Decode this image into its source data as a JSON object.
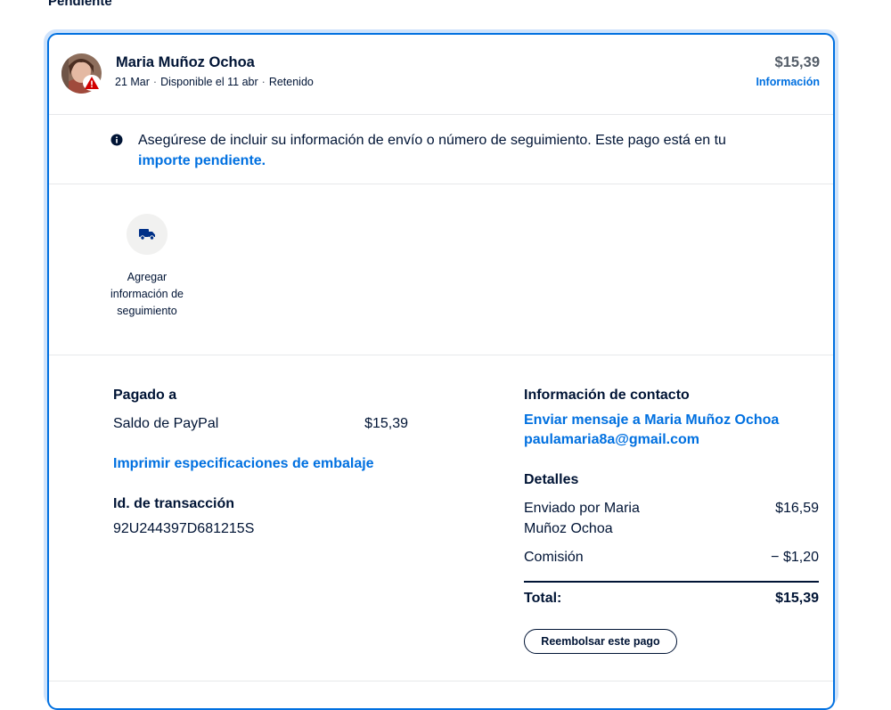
{
  "section": {
    "title": "Pendiente"
  },
  "header": {
    "name": "Maria Muñoz Ochoa",
    "date": "21 Mar",
    "available": "Disponible el 11 abr",
    "status": "Retenido",
    "amount": "$15,39",
    "info_link": "Información"
  },
  "notice": {
    "text": "Asegúrese de incluir su información de envío o número de seguimiento. Este pago está en tu",
    "link": "importe pendiente."
  },
  "tracking": {
    "label": "Agregar información de seguimiento",
    "icon": "truck-icon"
  },
  "paid_to": {
    "heading": "Pagado a",
    "source": "Saldo de PayPal",
    "amount": "$15,39",
    "print_link": "Imprimir especificaciones de embalaje"
  },
  "transaction": {
    "heading": "Id. de transacción",
    "id": "92U244397D681215S"
  },
  "contact": {
    "heading": "Información de contacto",
    "message_link": "Enviar mensaje a Maria Muñoz Ochoa",
    "email": "paulamaria8a@gmail.com"
  },
  "details": {
    "heading": "Detalles",
    "sent_by_line1": "Enviado por Maria",
    "sent_by_line2": "Muñoz Ochoa",
    "sent_amount": "$16,59",
    "fee_label": "Comisión",
    "fee_amount": "− $1,20",
    "total_label": "Total:",
    "total_amount": "$15,39"
  },
  "refund_button": "Reembolsar este pago",
  "colors": {
    "accent": "#0070e0",
    "text": "#001435",
    "card_border": "#0070e0",
    "card_glow": "#cfe3fb",
    "warning": "#d20000"
  }
}
